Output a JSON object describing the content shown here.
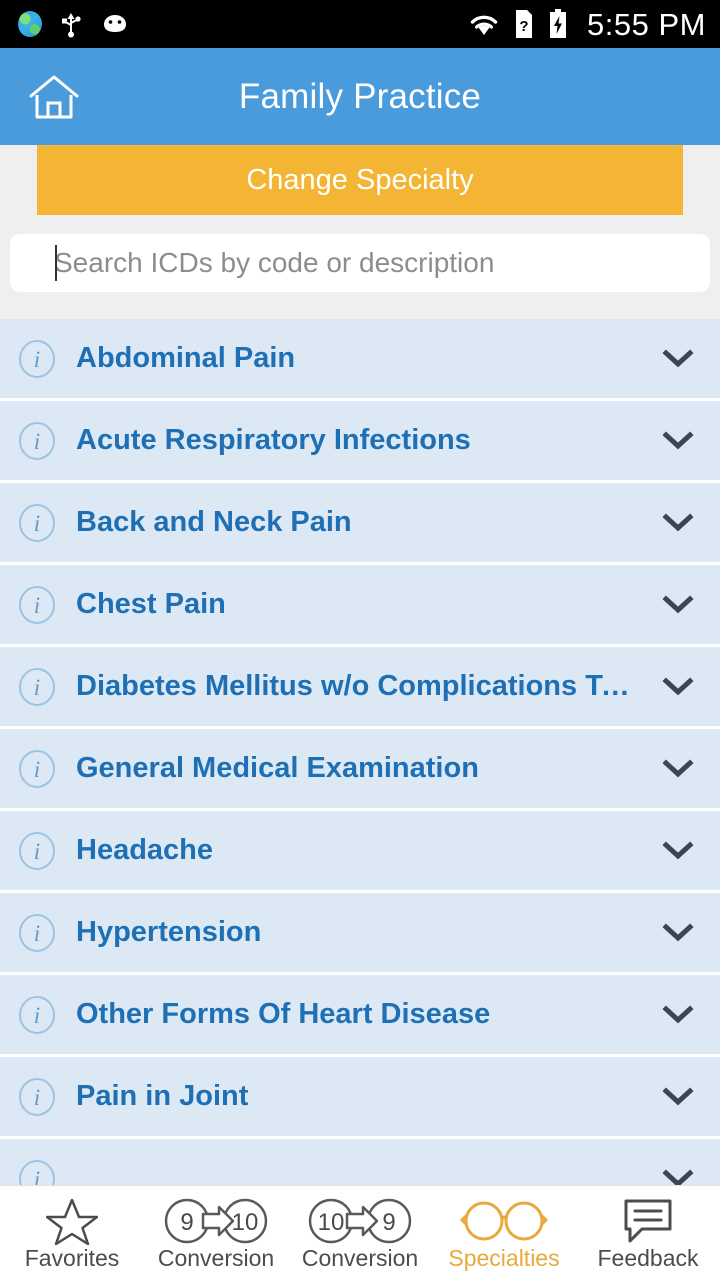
{
  "status_bar": {
    "time": "5:55 PM",
    "left_icons": [
      "globe-icon",
      "usb-icon",
      "android-icon"
    ],
    "right_icons": [
      "wifi-icon",
      "sim-question-icon",
      "battery-charging-icon"
    ]
  },
  "app_bar": {
    "home_icon": "home-icon",
    "title": "Family Practice"
  },
  "specialty": {
    "button_label": "Change Specialty",
    "color": "#F4B434"
  },
  "search": {
    "value": "",
    "placeholder": "Search ICDs by code or description"
  },
  "list": {
    "row_icon": "info-icon",
    "expand_icon": "chevron-down-icon",
    "accent": "#1F6FB5",
    "row_bg": "#DCE9F5",
    "items": [
      {
        "label": "Abdominal Pain"
      },
      {
        "label": "Acute Respiratory Infections"
      },
      {
        "label": "Back and Neck Pain"
      },
      {
        "label": "Chest Pain"
      },
      {
        "label": "Diabetes Mellitus w/o Complications Ty…"
      },
      {
        "label": "General Medical Examination"
      },
      {
        "label": "Headache"
      },
      {
        "label": "Hypertension"
      },
      {
        "label": "Other Forms Of Heart Disease"
      },
      {
        "label": "Pain in Joint"
      },
      {
        "label": ""
      }
    ]
  },
  "bottom_nav": {
    "active_color": "#E8A93C",
    "items": [
      {
        "label": "Favorites",
        "icon": "star-icon",
        "active": false
      },
      {
        "label": "Conversion",
        "icon": "convert-9-to-10-icon",
        "from": "9",
        "to": "10",
        "active": false
      },
      {
        "label": "Conversion",
        "icon": "convert-10-to-9-icon",
        "from": "10",
        "to": "9",
        "active": false
      },
      {
        "label": "Specialties",
        "icon": "glasses-icon",
        "active": true
      },
      {
        "label": "Feedback",
        "icon": "chat-bubble-icon",
        "active": false
      }
    ]
  }
}
